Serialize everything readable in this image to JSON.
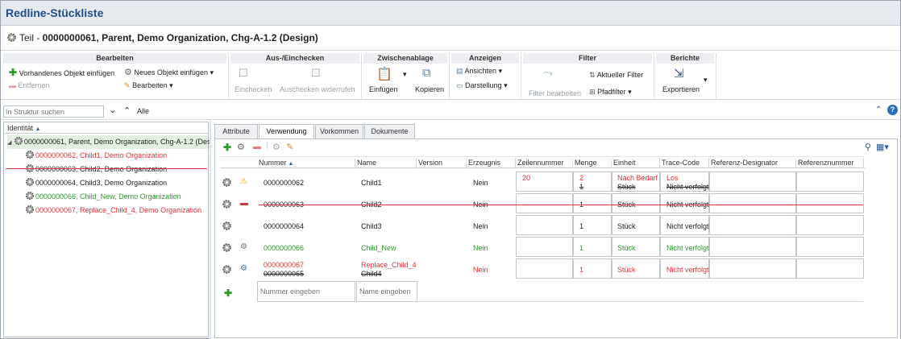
{
  "window": {
    "title": "Redline-Stückliste"
  },
  "header": {
    "prefix": "Teil - ",
    "part": "0000000061, Parent, Demo Organization, Chg-A-1.2 (Design)"
  },
  "ribbon": {
    "bearbeiten": {
      "title": "Bearbeiten",
      "add_existing": "Vorhandenes Objekt einfügen",
      "add_new": "Neues Objekt einfügen",
      "remove": "Entfernen",
      "edit": "Bearbeiten"
    },
    "checkin": {
      "title": "Aus-/Einchecken",
      "checkin": "Einchecken",
      "undo": "Auschecken widerrufen"
    },
    "clipboard": {
      "title": "Zwischenablage",
      "paste": "Einfügen",
      "copy": "Kopieren"
    },
    "views": {
      "title": "Anzeigen",
      "views": "Ansichten",
      "display": "Darstellung"
    },
    "filter": {
      "title": "Filter",
      "edit_filter": "Filter bearbeiten",
      "current_filter": "Aktueller Filter",
      "path_filter": "Pfadfilter"
    },
    "reports": {
      "title": "Berichte",
      "export": "Exportieren"
    }
  },
  "search": {
    "placeholder": "In Struktur suchen",
    "all_label": "Alle"
  },
  "tree": {
    "column": "Identität",
    "items": [
      {
        "label": "0000000061, Parent, Demo Organization, Chg-A-1.2 (Des"
      },
      {
        "label": "0000000062, Child1, Demo Organization"
      },
      {
        "label": "0000000063, Child2, Demo Organization"
      },
      {
        "label": "0000000064, Child3, Demo Organization"
      },
      {
        "label": "0000000066, Child_New, Demo Organization"
      },
      {
        "label": "0000000067, Replace_Child_4, Demo Organization"
      }
    ]
  },
  "tabs": [
    "Attribute",
    "Verwendung",
    "Vorkommen",
    "Dokumente"
  ],
  "columns": [
    "Nummer",
    "Name",
    "Version",
    "Erzeugnis",
    "Zeilennummer",
    "Menge",
    "Einheit",
    "Trace-Code",
    "Referenz-Designator",
    "Referenznummer"
  ],
  "rows": [
    {
      "nummer": "0000000062",
      "name": "Child1",
      "erzeugnis": "Nein",
      "zeile": "20",
      "menge_new": "2",
      "menge_old": "1",
      "einheit_new": "Nach Bedarf",
      "einheit_old": "Stück",
      "trace_new": "Los",
      "trace_old": "Nicht verfolgt"
    },
    {
      "nummer": "0000000063",
      "name": "Child2",
      "erzeugnis": "Nein",
      "menge": "1",
      "einheit": "Stück",
      "trace": "Nicht verfolgt"
    },
    {
      "nummer": "0000000064",
      "name": "Child3",
      "erzeugnis": "Nein",
      "menge": "1",
      "einheit": "Stück",
      "trace": "Nicht verfolgt"
    },
    {
      "nummer": "0000000066",
      "name": "Child_New",
      "erzeugnis": "Nein",
      "menge": "1",
      "einheit": "Stück",
      "trace": "Nicht verfolgt"
    },
    {
      "nummer_new": "0000000067",
      "nummer_old": "0000000065",
      "name_new": "Replace_Child_4",
      "name_old": "Child4",
      "erzeugnis": "Nein",
      "menge": "1",
      "einheit": "Stück",
      "trace": "Nicht verfolgt"
    }
  ],
  "new_row": {
    "nummer_placeholder": "Nummer eingeben",
    "name_placeholder": "Name eingeben"
  }
}
